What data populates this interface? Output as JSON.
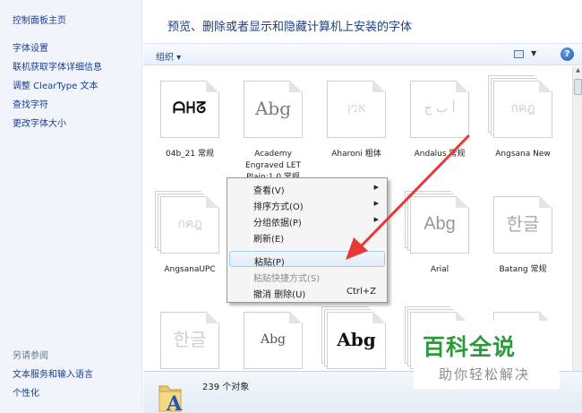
{
  "sidebar": {
    "home": "控制面板主页",
    "links": [
      "字体设置",
      "联机获取字体详细信息",
      "调整 ClearType 文本",
      "查找字符",
      "更改字体大小"
    ],
    "see_also_title": "另请参阅",
    "see_also": [
      "文本服务和输入语言",
      "个性化"
    ]
  },
  "header": {
    "title": "预览、删除或者显示和隐藏计算机上安装的字体"
  },
  "toolbar": {
    "organize": "组织 ▾",
    "help": "?"
  },
  "fonts": [
    {
      "name": "04b_21 常规",
      "sample": "ᗩᕼᘔ",
      "icon": "single-font-icon"
    },
    {
      "name": "Academy Engraved LET Plain:1.0 常规",
      "sample": "Abg",
      "icon": "single-font-icon"
    },
    {
      "name": "Aharoni 粗体",
      "sample": "אנץ",
      "icon": "single-font-icon"
    },
    {
      "name": "Andalus 常规",
      "sample": "أ ب ج",
      "icon": "single-font-icon"
    },
    {
      "name": "Angsana New",
      "sample": "กคฎ",
      "icon": "font-family-icon"
    },
    {
      "name": "AngsanaUPC",
      "sample": "กคฎ",
      "icon": "font-family-icon"
    },
    {
      "name": "Arial",
      "sample": "Abg",
      "icon": "font-family-icon"
    },
    {
      "name": "Batang 常规",
      "sample": "한글",
      "icon": "single-font-icon"
    },
    {
      "name": "",
      "sample": "한글",
      "icon": "single-font-icon"
    },
    {
      "name": "",
      "sample": "Abg",
      "icon": "single-font-icon"
    },
    {
      "name": "",
      "sample": "Abg",
      "icon": "font-family-icon"
    }
  ],
  "context_menu": {
    "items": [
      {
        "label": "查看(V)",
        "submenu": true
      },
      {
        "label": "排序方式(O)",
        "submenu": true
      },
      {
        "label": "分组依据(P)",
        "submenu": true
      },
      {
        "label": "刷新(E)"
      },
      {
        "label": "粘贴(P)",
        "highlighted": true
      },
      {
        "label": "粘贴快捷方式(S)",
        "disabled": true
      },
      {
        "label": "撤消 删除(U)",
        "accelerator": "Ctrl+Z"
      }
    ]
  },
  "status": {
    "count": "239 个对象",
    "icon": "fonts-folder-icon"
  },
  "watermark": {
    "title": "百科全说",
    "subtitle": "助你轻松解决"
  },
  "colors": {
    "link": "#1a3e8c",
    "arrow": "#e53935",
    "watermark_green": "#2b9a3b",
    "menu_highlight": "#e0ebf9"
  }
}
